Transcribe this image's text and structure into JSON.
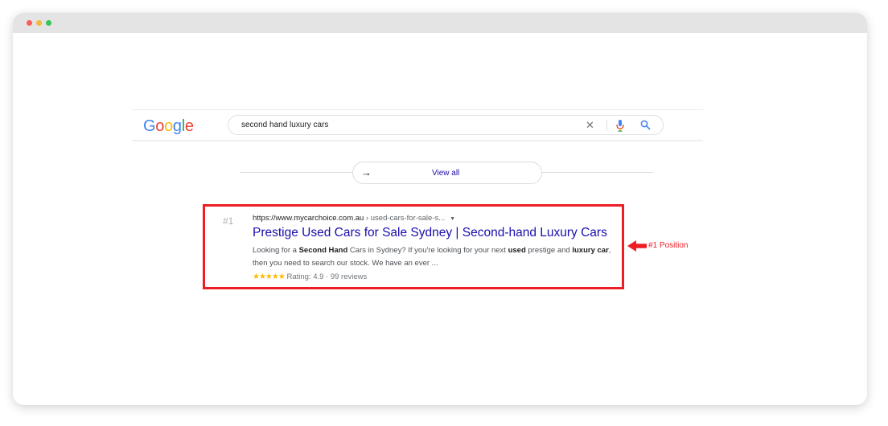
{
  "search": {
    "query": "second hand luxury cars",
    "logo_letters": [
      {
        "ch": "G",
        "color": "#4285f4"
      },
      {
        "ch": "o",
        "color": "#ea4335"
      },
      {
        "ch": "o",
        "color": "#fbbc05"
      },
      {
        "ch": "g",
        "color": "#4285f4"
      },
      {
        "ch": "l",
        "color": "#34a853"
      },
      {
        "ch": "e",
        "color": "#ea4335"
      }
    ]
  },
  "view_all": {
    "label": "View all"
  },
  "result": {
    "rank": "#1",
    "url_domain": "https://www.mycarchoice.com.au",
    "url_path": " › used-cars-for-sale-s...",
    "title": "Prestige Used Cars for Sale Sydney | Second-hand Luxury Cars",
    "snippet": {
      "s1": "Looking for a ",
      "b1": "Second Hand",
      "s2": " Cars in Sydney? If you're looking for your next ",
      "b2": "used",
      "s3": " prestige and ",
      "b3": "luxury car",
      "s4": ", then you need to search our stock. We have an ever ..."
    },
    "stars": "★★★★★",
    "rating_text": " Rating: 4.9 · 99 reviews"
  },
  "annotation": {
    "label": "#1 Position",
    "color": "#ee1c24"
  }
}
